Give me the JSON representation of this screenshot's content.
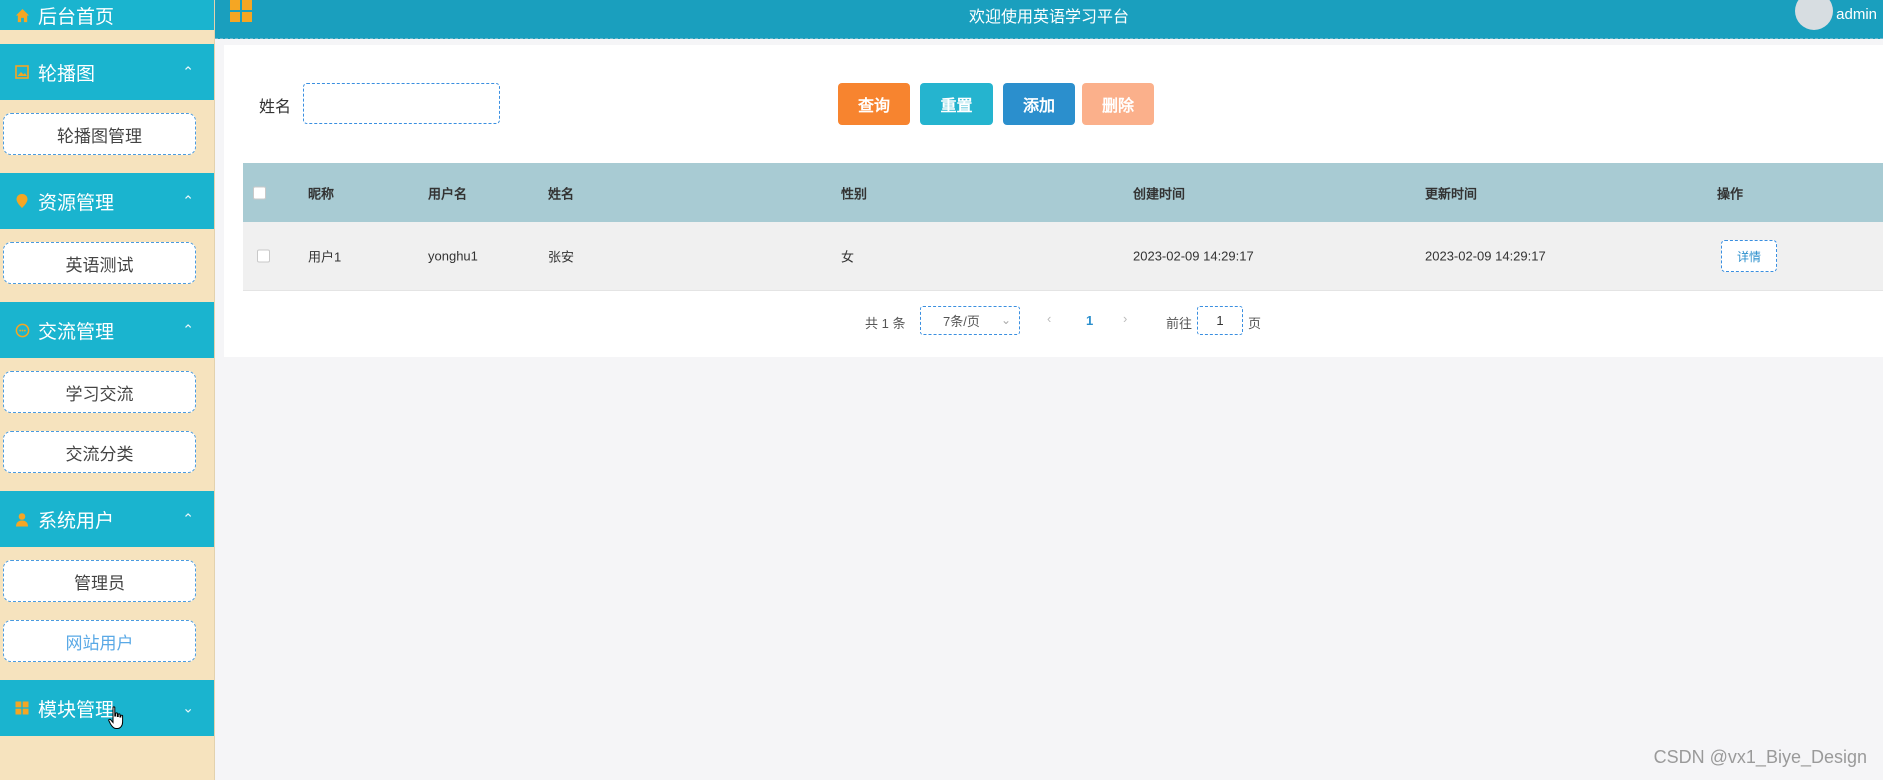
{
  "sidebar": {
    "home_label": "后台首页",
    "groups": [
      {
        "label": "轮播图",
        "icon": "image-icon",
        "items": [
          "轮播图管理"
        ]
      },
      {
        "label": "资源管理",
        "icon": "location-pin-icon",
        "items": [
          "英语测试"
        ]
      },
      {
        "label": "交流管理",
        "icon": "chat-icon",
        "items": [
          "学习交流",
          "交流分类"
        ]
      },
      {
        "label": "系统用户",
        "icon": "user-icon",
        "items": [
          "管理员",
          "网站用户"
        ]
      },
      {
        "label": "模块管理",
        "icon": "grid-icon",
        "items": []
      }
    ],
    "active_item": "网站用户"
  },
  "header": {
    "title": "欢迎使用英语学习平台",
    "user": "admin"
  },
  "search": {
    "label": "姓名",
    "value": ""
  },
  "buttons": {
    "query": "查询",
    "reset": "重置",
    "add": "添加",
    "delete": "删除"
  },
  "table": {
    "columns": [
      "昵称",
      "用户名",
      "姓名",
      "性别",
      "创建时间",
      "更新时间",
      "操作"
    ],
    "rows": [
      {
        "nickname": "用户1",
        "username": "yonghu1",
        "name": "张安",
        "gender": "女",
        "created": "2023-02-09 14:29:17",
        "updated": "2023-02-09 14:29:17",
        "action": "详情"
      }
    ]
  },
  "pagination": {
    "total_text": "共 1 条",
    "page_size": "7条/页",
    "current_page": "1",
    "goto_label": "前往",
    "goto_value": "1",
    "page_suffix": "页"
  },
  "watermark": "CSDN @vx1_Biye_Design",
  "colors": {
    "sidebar_bg": "#f6e3be",
    "menu_head": "#1ab4cf",
    "topbar": "#1a9fbe",
    "query": "#f7842f",
    "reset": "#25b4cf",
    "add": "#2b8fcd",
    "delete": "#fbb08b",
    "table_head": "#a8cbd3"
  }
}
